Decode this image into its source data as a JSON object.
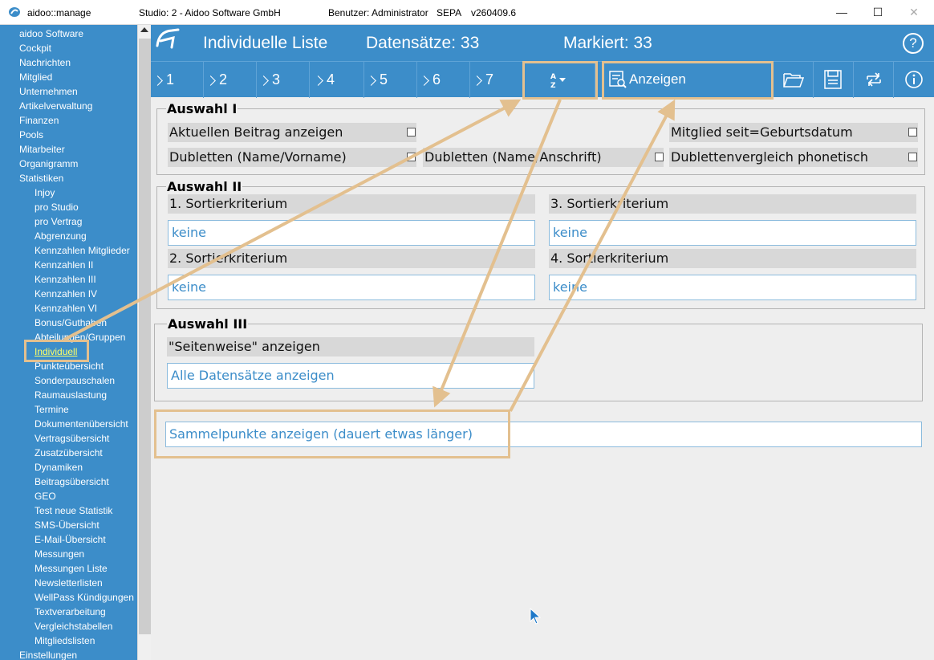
{
  "titlebar": {
    "app_name": "aidoo::manage",
    "studio": "Studio: 2 - Aidoo Software GmbH",
    "user": "Benutzer: Administrator",
    "sepa": "SEPA",
    "version": "v260409.6",
    "minimize": "—",
    "maximize": "☐",
    "close": "✕"
  },
  "sidebar": {
    "items": [
      {
        "label": "aidoo Software",
        "level": 0
      },
      {
        "label": "Cockpit",
        "level": 0
      },
      {
        "label": "Nachrichten",
        "level": 0
      },
      {
        "label": "Mitglied",
        "level": 0
      },
      {
        "label": "Unternehmen",
        "level": 0
      },
      {
        "label": "Artikelverwaltung",
        "level": 0
      },
      {
        "label": "Finanzen",
        "level": 0
      },
      {
        "label": "Pools",
        "level": 0
      },
      {
        "label": "Mitarbeiter",
        "level": 0
      },
      {
        "label": "Organigramm",
        "level": 0
      },
      {
        "label": "Statistiken",
        "level": 0
      },
      {
        "label": "Injoy",
        "level": 1
      },
      {
        "label": "pro Studio",
        "level": 1
      },
      {
        "label": "pro Vertrag",
        "level": 1
      },
      {
        "label": "Abgrenzung",
        "level": 1
      },
      {
        "label": "Kennzahlen Mitglieder",
        "level": 1
      },
      {
        "label": "Kennzahlen II",
        "level": 1
      },
      {
        "label": "Kennzahlen III",
        "level": 1
      },
      {
        "label": "Kennzahlen IV",
        "level": 1
      },
      {
        "label": "Kennzahlen VI",
        "level": 1
      },
      {
        "label": "Bonus/Guthaben",
        "level": 1
      },
      {
        "label": "Abteilungen/Gruppen",
        "level": 1
      },
      {
        "label": "Individuell",
        "level": 1,
        "active": true
      },
      {
        "label": "Punkteübersicht",
        "level": 1
      },
      {
        "label": "Sonderpauschalen",
        "level": 1
      },
      {
        "label": "Raumauslastung",
        "level": 1
      },
      {
        "label": "Termine",
        "level": 1
      },
      {
        "label": "Dokumentenübersicht",
        "level": 1
      },
      {
        "label": "Vertragsübersicht",
        "level": 1
      },
      {
        "label": "Zusatzübersicht",
        "level": 1
      },
      {
        "label": "Dynamiken",
        "level": 1
      },
      {
        "label": "Beitragsübersicht",
        "level": 1
      },
      {
        "label": "GEO",
        "level": 1
      },
      {
        "label": "Test neue Statistik",
        "level": 1
      },
      {
        "label": "SMS-Übersicht",
        "level": 1
      },
      {
        "label": "E-Mail-Übersicht",
        "level": 1
      },
      {
        "label": "Messungen",
        "level": 1
      },
      {
        "label": "Messungen Liste",
        "level": 1
      },
      {
        "label": "Newsletterlisten",
        "level": 1
      },
      {
        "label": "WellPass Kündigungen",
        "level": 1
      },
      {
        "label": "Textverarbeitung",
        "level": 1
      },
      {
        "label": "Vergleichstabellen",
        "level": 1
      },
      {
        "label": "Mitgliedslisten",
        "level": 1
      },
      {
        "label": "Einstellungen",
        "level": 0
      }
    ]
  },
  "header": {
    "title": "Individuelle Liste",
    "count": "Datensätze: 33",
    "marked": "Markiert: 33",
    "help": "?"
  },
  "toolbar": {
    "steps": [
      "1",
      "2",
      "3",
      "4",
      "5",
      "6",
      "7"
    ],
    "show_label": "Anzeigen",
    "icons": [
      "folder-open-icon",
      "save-icon",
      "swap-icon",
      "info-icon"
    ]
  },
  "auswahl1": {
    "legend": "Auswahl I",
    "aktuellen_beitrag": "Aktuellen Beitrag anzeigen",
    "mitglied_seit": "Mitglied seit=Geburtsdatum",
    "dubletten_name": "Dubletten (Name/Vorname)",
    "dubletten_anschrift": "Dubletten (Name/Anschrift)",
    "dubletten_phonetisch": "Dublettenvergleich phonetisch"
  },
  "auswahl2": {
    "legend": "Auswahl II",
    "sort1_label": "1. Sortierkriterium",
    "sort1_value": "keine",
    "sort2_label": "2. Sortierkriterium",
    "sort2_value": "keine",
    "sort3_label": "3. Sortierkriterium",
    "sort3_value": "keine",
    "sort4_label": "4. Sortierkriterium",
    "sort4_value": "keine"
  },
  "auswahl3": {
    "legend": "Auswahl III",
    "seitenweise_label": "\"Seitenweise\" anzeigen",
    "seitenweise_value": "Alle Datensätze anzeigen"
  },
  "sammelpunkte": "Sammelpunkte anzeigen (dauert etwas länger)",
  "colors": {
    "brand_blue": "#3c8dc9",
    "highlight": "#e3c08f",
    "panel": "#eeeeee"
  }
}
